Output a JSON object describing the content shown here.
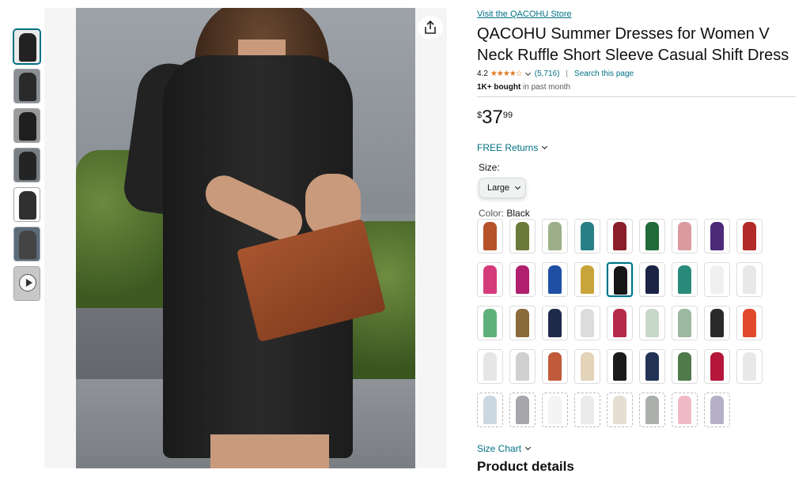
{
  "store_link": "Visit the QACOHU Store",
  "title": "QACOHU Summer Dresses for Women V Neck Ruffle Short Sleeve Casual Shift Dress",
  "rating": {
    "value": "4.2",
    "stars": "★★★★☆",
    "count": "(5,716)",
    "search": "Search this page"
  },
  "bought": {
    "bold": "1K+ bought",
    "rest": " in past month"
  },
  "price": {
    "symbol": "$",
    "whole": "37",
    "fraction": "99"
  },
  "returns": "FREE Returns",
  "size": {
    "label": "Size:",
    "selected": "Large"
  },
  "color": {
    "label": "Color: ",
    "selected": "Black"
  },
  "size_chart": "Size Chart",
  "product_details": "Product details",
  "thumbnails": [
    {
      "color": "#222222",
      "bg": "#e9e9e9"
    },
    {
      "color": "#2a2a2a",
      "bg": "#8b8f94"
    },
    {
      "color": "#1f1f1f",
      "bg": "#9a9a9a"
    },
    {
      "color": "#242424",
      "bg": "#7a7f86"
    },
    {
      "color": "#303030",
      "bg": "#ffffff"
    },
    {
      "color": "#444444",
      "bg": "#5a6b7a"
    },
    {
      "color": "#555555",
      "bg": "#c8c8c8",
      "video": true
    }
  ],
  "swatches": [
    [
      "#b5532b",
      "#6b7a3a",
      "#9caf88",
      "#2a7f86",
      "#8a1f2b",
      "#1f6b3a",
      "#d99aa0",
      "#4b2a7a",
      "#b32a2a"
    ],
    [
      "#d43b7a",
      "#b0206e",
      "#1f4fa3",
      "#c9a43a",
      "#161616",
      "#1c2446",
      "#2a8a7a",
      "#f0f0f0",
      "#e8e8e8"
    ],
    [
      "#5fb07a",
      "#8a6a3a",
      "#1e2a4a",
      "#dcdcdc",
      "#b52a4a",
      "#c8d8c8",
      "#9cb8a0",
      "#2a2a2a",
      "#e04a2a"
    ],
    [
      "#e6e6e6",
      "#d0d0d0",
      "#c05a3a",
      "#e3d3b8",
      "#1a1a1a",
      "#223355",
      "#4f7a4a",
      "#b5163a",
      "#e8e8e8"
    ],
    [
      "#b9c9d6",
      "#8a8a8f",
      "#f0f0f0",
      "#e4e4e4",
      "#ded3c4",
      "#8f9590",
      "#e9a3b3",
      "#9d94b5"
    ]
  ]
}
